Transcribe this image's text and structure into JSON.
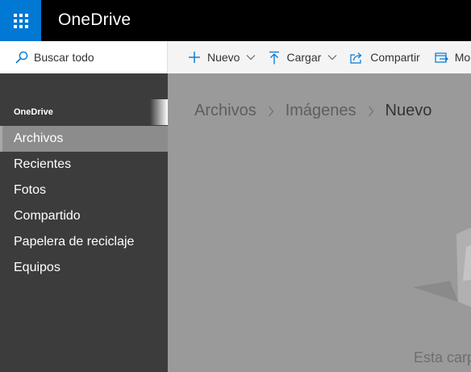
{
  "app": {
    "title": "OneDrive"
  },
  "search": {
    "label": "Buscar todo"
  },
  "commands": [
    {
      "label": "Nuevo",
      "icon": "plus-icon",
      "has_menu": true
    },
    {
      "label": "Cargar",
      "icon": "upload-icon",
      "has_menu": true
    },
    {
      "label": "Compartir",
      "icon": "share-icon",
      "has_menu": false
    },
    {
      "label": "Mo",
      "icon": "move-icon",
      "has_menu": false
    }
  ],
  "nav": {
    "heading": "OneDrive",
    "items": [
      {
        "label": "Archivos",
        "selected": true
      },
      {
        "label": "Recientes"
      },
      {
        "label": "Fotos"
      },
      {
        "label": "Compartido"
      },
      {
        "label": "Papelera de reciclaje"
      },
      {
        "label": "Equipos"
      }
    ]
  },
  "breadcrumb": [
    "Archivos",
    "Imágenes",
    "Nuevo"
  ],
  "empty_state": {
    "text": "Esta carp"
  },
  "colors": {
    "brand_blue": "#0078d4",
    "suite_bar": "#000000",
    "nav_background": "#3c3c3c",
    "overlay_gray": "#9a9a9a"
  }
}
